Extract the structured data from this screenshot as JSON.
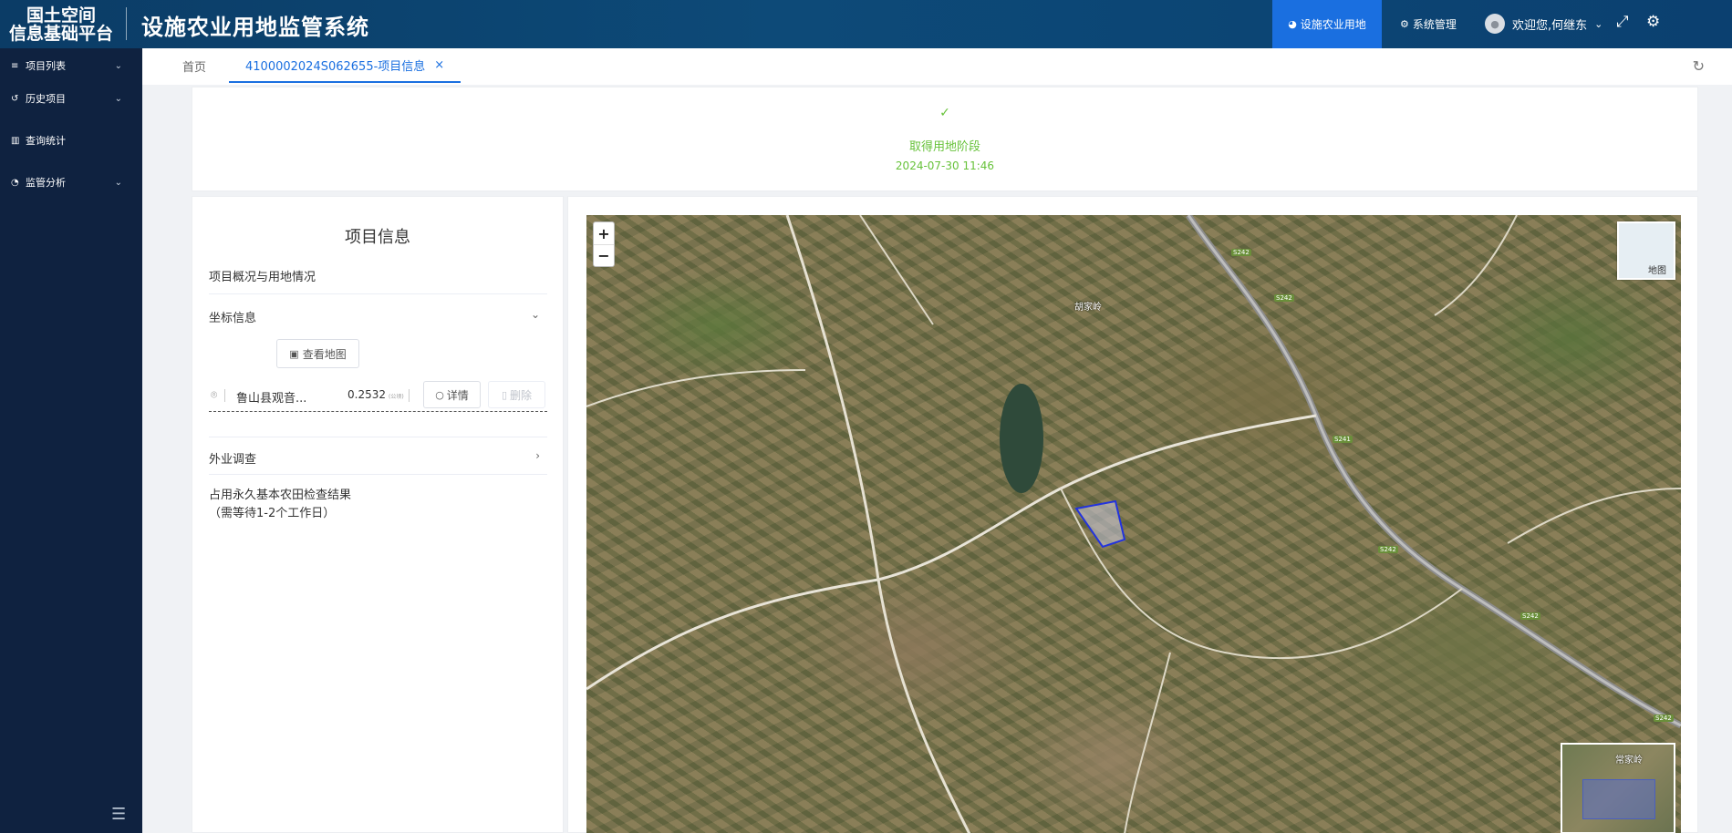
{
  "header": {
    "brand_line1": "国土空间",
    "brand_line2": "信息基础平台",
    "app_title": "设施农业用地监管系统",
    "nav": [
      {
        "label": "设施农业用地",
        "active": true
      },
      {
        "label": "系统管理",
        "active": false
      }
    ],
    "welcome": "欢迎您,何继东"
  },
  "sidebar": {
    "items": [
      {
        "label": "项目列表",
        "has_children": true
      },
      {
        "label": "历史项目",
        "has_children": true
      },
      {
        "label": "查询统计",
        "has_children": false
      },
      {
        "label": "监管分析",
        "has_children": true
      }
    ]
  },
  "tabs": {
    "home": "首页",
    "project": "4100002024S062655-项目信息"
  },
  "stage": {
    "name": "取得用地阶段",
    "time": "2024-07-30 11:46"
  },
  "info": {
    "title": "项目信息",
    "overview": "项目概况与用地情况",
    "coord_section": "坐标信息",
    "view_map": "查看地图",
    "coord": {
      "location": "鲁山县观音...",
      "area": "0.2532",
      "area_unit": "(公顷)",
      "detail": "详情",
      "delete": "删除"
    },
    "field_survey": "外业调查",
    "result_line1": "占用永久基本农田检查结果",
    "result_line2": "（需等待1-2个工作日）"
  },
  "map": {
    "layer_label": "地图",
    "overview_label": "常家岭",
    "village_label": "胡家岭",
    "road_tags": [
      "S242",
      "S242",
      "S241",
      "S242",
      "S242",
      "S242"
    ]
  },
  "colors": {
    "header_bg": "#0b3c66",
    "sidebar_bg": "#0f2240",
    "accent": "#1a6fe0",
    "success": "#67c23a"
  }
}
